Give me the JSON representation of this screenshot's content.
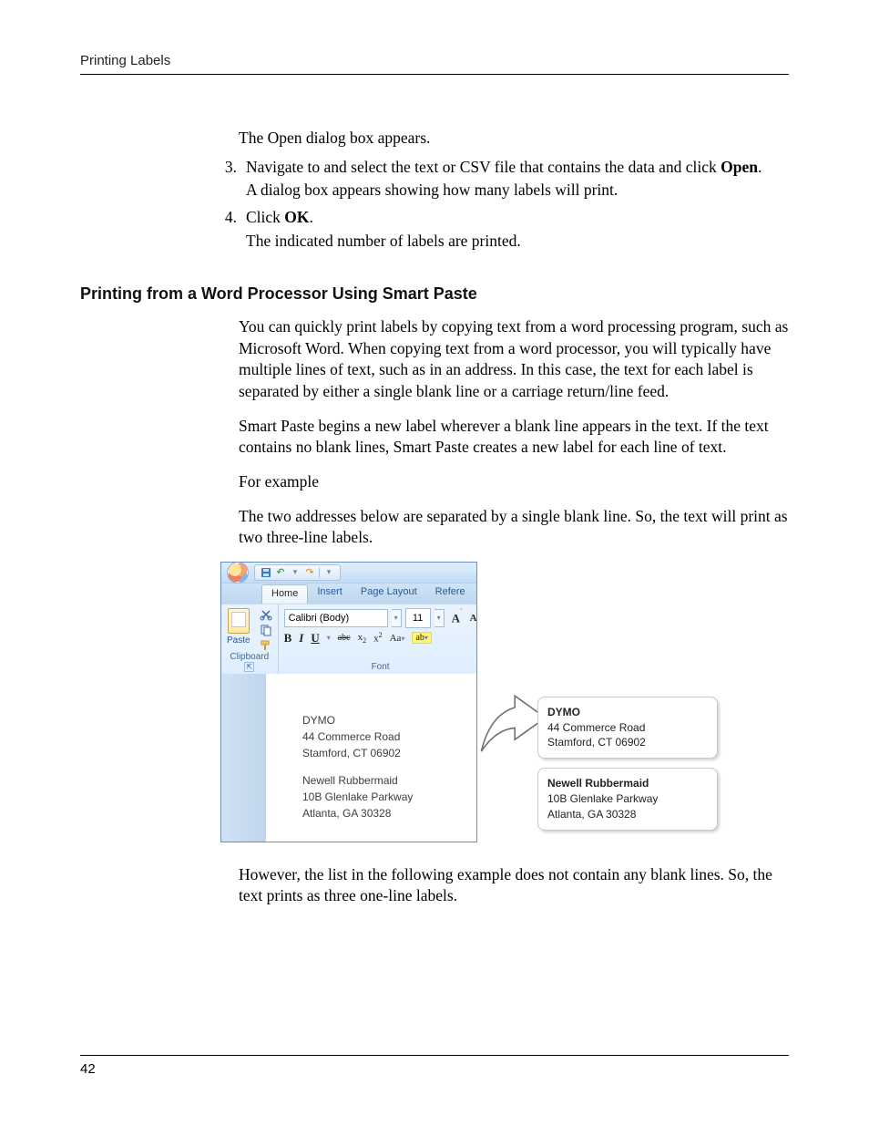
{
  "header": {
    "running_title": "Printing Labels"
  },
  "intro": {
    "open_dialog": "The Open dialog box appears."
  },
  "steps": {
    "s3_num": "3.",
    "s3_text_a": "Navigate to and select the text or CSV file that contains the data and click ",
    "s3_bold": "Open",
    "s3_text_b": ".",
    "s3_sub": "A dialog box appears showing how many labels will print.",
    "s4_num": "4.",
    "s4_text_a": "Click ",
    "s4_bold": "OK",
    "s4_text_b": ".",
    "s4_sub": "The indicated number of labels are printed."
  },
  "section_heading": "Printing from a Word Processor Using Smart Paste",
  "body": {
    "p1": "You can quickly print labels by copying text from a word processing program, such as Microsoft Word. When copying text from a word processor, you will typically have multiple lines of text, such as in an address. In this case, the text for each label is separated by either a single blank line or a carriage return/line feed.",
    "p2": "Smart Paste begins a new label wherever a blank line appears in the text. If the text contains no blank lines, Smart Paste creates a new label for each line of text.",
    "p3": "For example",
    "p4": "The two addresses below are separated by a single blank line.  So, the text will print as two three-line labels.",
    "p5": "However, the list in the following example does not contain any blank lines. So, the text prints as three one-line labels."
  },
  "word": {
    "tabs": {
      "home": "Home",
      "insert": "Insert",
      "page_layout": "Page Layout",
      "references": "Refere"
    },
    "clipboard_label": "Clipboard",
    "paste_label": "Paste",
    "font_label": "Font",
    "font_name": "Calibri (Body)",
    "font_size": "11",
    "buttons": {
      "bold": "B",
      "italic": "I",
      "underline": "U",
      "strike": "abc",
      "sub": "x",
      "sub2": "2",
      "sup": "x",
      "sup2": "2",
      "caseA": "Aa",
      "highlight": "ab",
      "grow": "A",
      "growmark": "ˆ",
      "extraA": "A"
    },
    "doc": {
      "a1_title": "DYMO",
      "a1_l1": "44 Commerce Road",
      "a1_l2": "Stamford, CT 06902",
      "a2_title": "Newell Rubbermaid",
      "a2_l1": "10B Glenlake Parkway",
      "a2_l2": "Atlanta, GA 30328"
    }
  },
  "labels": {
    "l1_title": "DYMO",
    "l1_l1": "44 Commerce Road",
    "l1_l2": "Stamford, CT 06902",
    "l2_title": "Newell Rubbermaid",
    "l2_l1": "10B Glenlake Parkway",
    "l2_l2": "Atlanta, GA 30328"
  },
  "page_number": "42"
}
